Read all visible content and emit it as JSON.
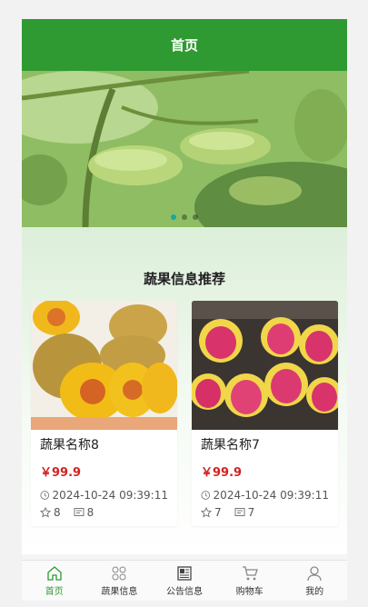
{
  "header": {
    "title": "首页"
  },
  "banner": {
    "slide_count": 3,
    "active_index": 0
  },
  "recommend": {
    "title": "蔬果信息推荐",
    "items": [
      {
        "name": "蔬果名称8",
        "price": "￥99.9",
        "time": "2024-10-24 09:39:11",
        "likes": "8",
        "comments": "8",
        "image": "kiwi-fruit-image"
      },
      {
        "name": "蔬果名称7",
        "price": "￥99.9",
        "time": "2024-10-24 09:39:11",
        "likes": "7",
        "comments": "7",
        "image": "dragon-fruit-image"
      }
    ]
  },
  "tabbar": {
    "items": [
      {
        "label": "首页",
        "icon": "home-icon",
        "active": true
      },
      {
        "label": "蔬果信息",
        "icon": "grid-icon",
        "active": false
      },
      {
        "label": "公告信息",
        "icon": "news-icon",
        "active": false
      },
      {
        "label": "购物车",
        "icon": "cart-icon",
        "active": false
      },
      {
        "label": "我的",
        "icon": "user-icon",
        "active": false
      }
    ]
  },
  "colors": {
    "primary": "#2f9a32",
    "price": "#d32121",
    "indicator": "#19a7a2"
  }
}
